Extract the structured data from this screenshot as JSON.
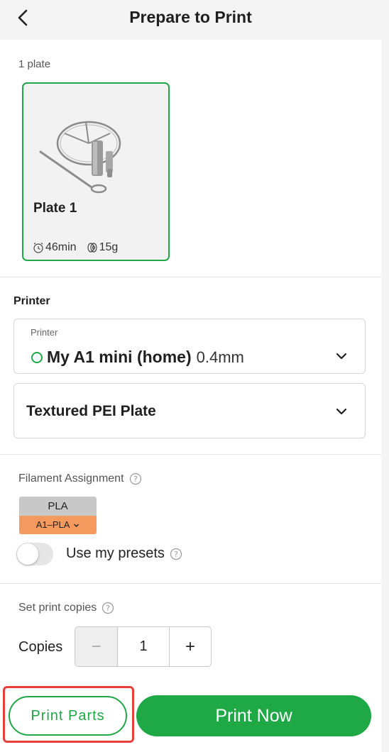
{
  "header": {
    "title": "Prepare to Print"
  },
  "plates": {
    "count_label": "1 plate",
    "items": [
      {
        "name": "Plate 1",
        "time": "46min",
        "weight": "15g"
      }
    ]
  },
  "printer_section": {
    "label": "Printer",
    "printer_caption": "Printer",
    "printer_name": "My A1 mini (home)",
    "nozzle": "0.4mm",
    "status_color": "#1fa846",
    "plate_type": "Textured PEI Plate"
  },
  "filament": {
    "label": "Filament Assignment",
    "chip_material": "PLA",
    "chip_slot": "A1–PLA",
    "chip_top_color": "#c8c8c8",
    "chip_bottom_color": "#f59a5e"
  },
  "presets": {
    "label": "Use my presets",
    "enabled": false
  },
  "copies": {
    "section_label": "Set print copies",
    "label": "Copies",
    "minus": "−",
    "value": "1",
    "plus": "+"
  },
  "actions": {
    "print_parts": "Print Parts",
    "print_now": "Print Now",
    "accent_color": "#1fa846",
    "highlight_color": "#e5403a"
  }
}
